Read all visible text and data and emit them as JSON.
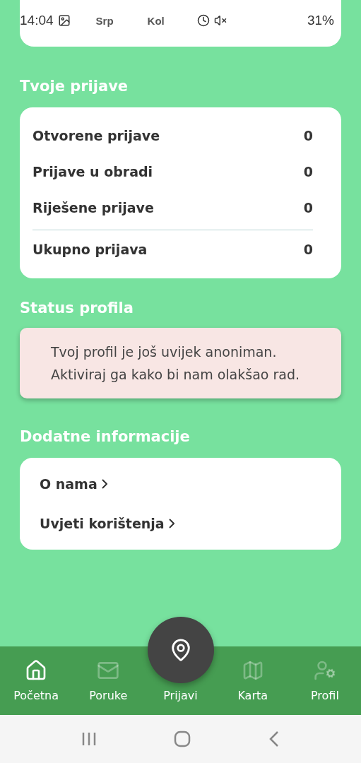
{
  "status_bar": {
    "time": "14:04",
    "battery": "31%"
  },
  "chart_card": {
    "month_labels": [
      "Srp",
      "Kol"
    ]
  },
  "reports": {
    "title": "Tvoje prijave",
    "rows": [
      {
        "label": "Otvorene prijave",
        "value": "0",
        "kind": "item"
      },
      {
        "label": "Prijave u obradi",
        "value": "0",
        "kind": "item"
      },
      {
        "label": "Riješene prijave",
        "value": "0",
        "kind": "item"
      },
      {
        "label": "Ukupno prijava",
        "value": "0",
        "kind": "total"
      }
    ]
  },
  "profile_status": {
    "title": "Status profila",
    "message": "Tvoj profil je još uvijek anoniman. Aktiviraj ga kako bi nam olakšao rad."
  },
  "info": {
    "title": "Dodatne informacije",
    "links": [
      {
        "label": "O nama"
      },
      {
        "label": "Uvjeti korištenja"
      }
    ]
  },
  "bottom_nav": {
    "items": [
      {
        "label": "Početna",
        "selected": true
      },
      {
        "label": "Poruke",
        "selected": false
      },
      {
        "label": "Prijavi",
        "selected": false
      },
      {
        "label": "Karta",
        "selected": false
      },
      {
        "label": "Profil",
        "selected": false
      }
    ]
  }
}
